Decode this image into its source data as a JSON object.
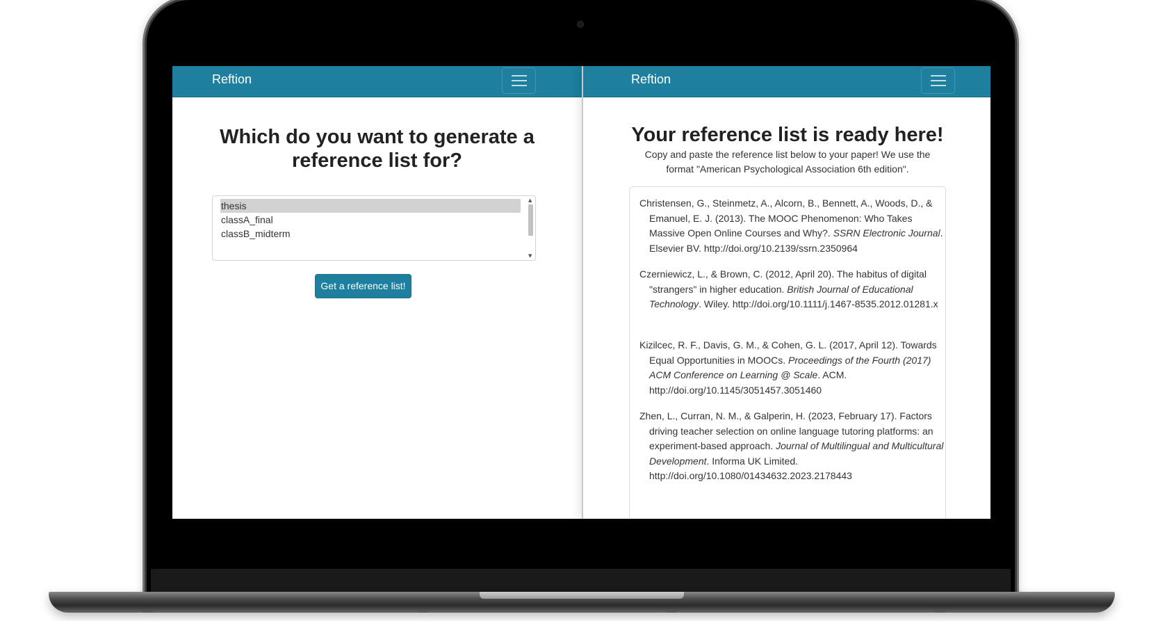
{
  "left_pane": {
    "brand": "Reftion",
    "menu_icon": "hamburger-menu-icon",
    "heading_line1": "Which do you want to generate a",
    "heading_line2": "reference list for?",
    "listbox": {
      "selected": "thesis",
      "options": [
        "thesis",
        "classA_final",
        "classB_midterm"
      ]
    },
    "button_label": "Get a reference list!"
  },
  "right_pane": {
    "brand": "Reftion",
    "menu_icon": "hamburger-menu-icon",
    "heading": "Your reference list is ready here!",
    "description_line1": "Copy and paste the reference list below to your paper! We use the",
    "description_line2": "format \"American Psychological Association 6th edition\".",
    "references": [
      {
        "pre": "Christensen, G., Steinmetz, A., Alcorn, B., Bennett, A., Woods, D., & Emanuel, E. J. (2013). The MOOC Phenomenon: Who Takes Massive Open Online Courses and Why?. ",
        "journal": "SSRN Electronic Journal",
        "post": ". Elsevier BV. http://doi.org/10.2139/ssrn.2350964"
      },
      {
        "pre": "Czerniewicz, L., & Brown, C. (2012, April 20). The habitus of digital \"strangers\" in higher education. ",
        "journal": "British Journal of Educational Technology",
        "post": ". Wiley. http://doi.org/10.1111/j.1467-8535.2012.01281.x"
      },
      {
        "pre": "Kizilcec, R. F., Davis, G. M., & Cohen, G. L. (2017, April 12). Towards Equal Opportunities in MOOCs. ",
        "journal": "Proceedings of the Fourth (2017) ACM Conference on Learning @ Scale",
        "post": ". ACM. http://doi.org/10.1145/3051457.3051460"
      },
      {
        "pre": "Zhen, L., Curran, N. M., & Galperin, H. (2023, February 17). Factors driving teacher selection on online language tutoring platforms: an experiment-based approach. ",
        "journal": "Journal of Multilingual and Multicultural Development",
        "post": ". Informa UK Limited. http://doi.org/10.1080/01434632.2023.2178443"
      }
    ]
  },
  "colors": {
    "navbar": "#1e7f9e",
    "button": "#1e7f9e",
    "selected_option": "#d2d2d2",
    "frame": "#000000"
  }
}
